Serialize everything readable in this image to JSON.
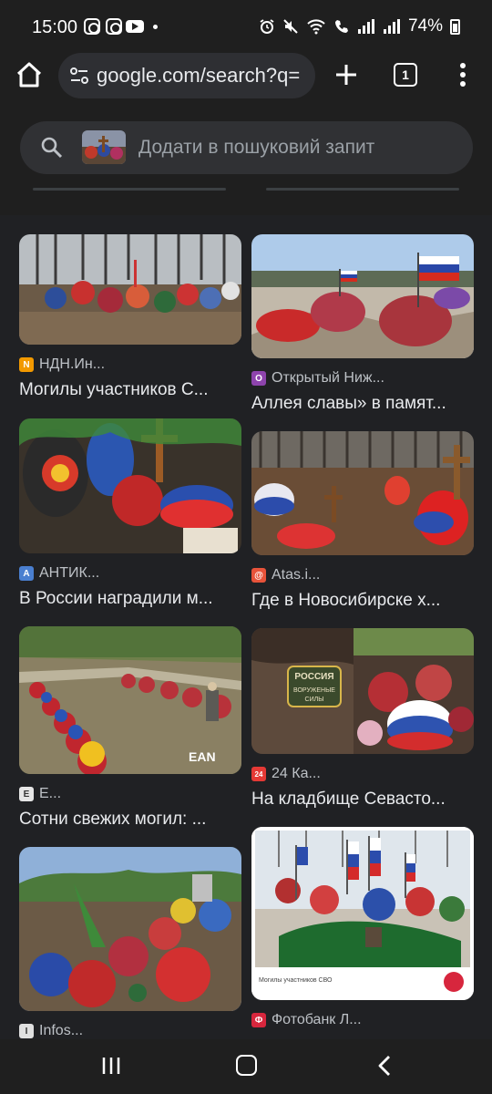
{
  "status_bar": {
    "time": "15:00",
    "battery": "74%"
  },
  "browser": {
    "url": "google.com/search?q=",
    "tab_count": "1"
  },
  "search": {
    "placeholder": "Додати в пошуковий запит"
  },
  "results": [
    {
      "source": "НДН.Ин...",
      "title": "Могилы участников С...",
      "icon_color": "#f29900",
      "icon_glyph": "N"
    },
    {
      "source": "Открытый Ниж...",
      "title": "Аллея славы» в памят...",
      "icon_color": "#8e44ad",
      "icon_glyph": "О"
    },
    {
      "source": "АНТИК...",
      "title": "В России наградили м...",
      "icon_color": "#4a7fd0",
      "icon_glyph": "A"
    },
    {
      "source": "Atas.i...",
      "title": "Где в Новосибирске х...",
      "icon_color": "#e8533a",
      "icon_glyph": "@"
    },
    {
      "source": "Е...",
      "title": "Сотни свежих могил: ...",
      "icon_color": "#e6e6e6",
      "icon_glyph": "Е"
    },
    {
      "source": "24 Ка...",
      "title": "На кладбище Севасто...",
      "icon_color": "#e53935",
      "icon_glyph": "24"
    },
    {
      "source": "Infos...",
      "title": "",
      "icon_color": "#e0e0e0",
      "icon_glyph": "I"
    },
    {
      "source": "Фотобанк Л...",
      "title": "",
      "icon_color": "#d7263d",
      "icon_glyph": "Ф"
    }
  ],
  "image_text": {
    "patch_top": "РОССИЯ",
    "patch_mid": "ВОРУЖЕНЫЕ",
    "patch_bottom": "СИЛЫ",
    "watermark": "EAN",
    "caption": "Могилы участников СВО"
  },
  "colors": {
    "background": "#202124",
    "url_box": "#2e2f33",
    "search_bar": "#303134"
  }
}
